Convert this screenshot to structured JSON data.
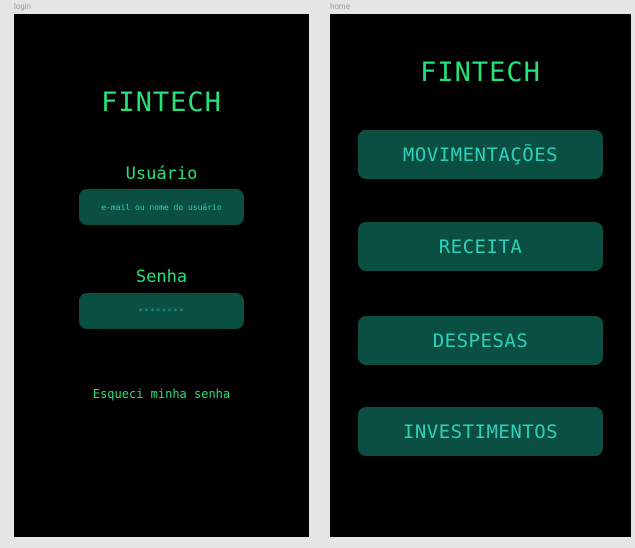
{
  "login": {
    "frame_label": "login",
    "title": "FINTECH",
    "username_label": "Usuário",
    "username_placeholder": "e-mail ou nome do usuário",
    "password_label": "Senha",
    "password_placeholder": "********",
    "forgot_password": "Esqueci minha senha"
  },
  "home": {
    "frame_label": "home",
    "title": "FINTECH",
    "menu": [
      {
        "label": "MOVIMENTAÇÕES"
      },
      {
        "label": "RECEITA"
      },
      {
        "label": "DESPESAS"
      },
      {
        "label": "INVESTIMENTOS"
      }
    ]
  },
  "colors": {
    "background": "#000000",
    "accent_green": "#26e07a",
    "button_fill": "#0b4f43",
    "button_text": "#2fd0b8",
    "canvas": "#e5e5e5"
  }
}
